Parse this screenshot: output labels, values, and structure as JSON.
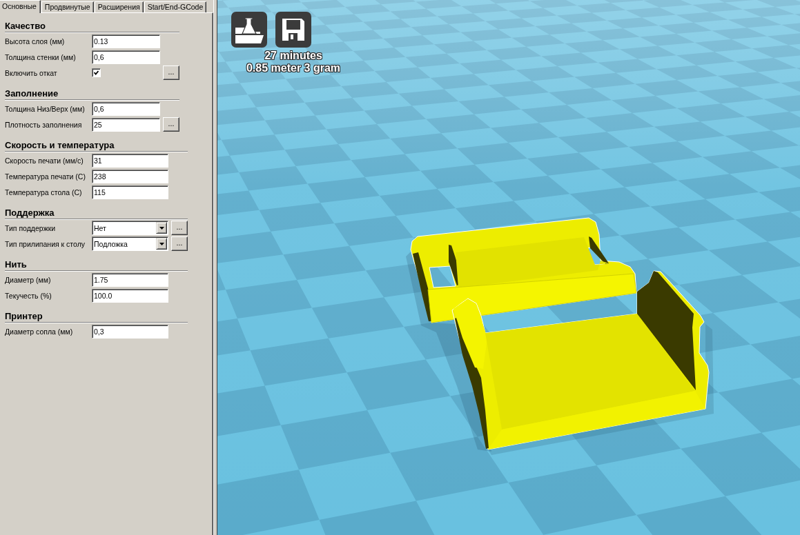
{
  "tabs": [
    {
      "label": "Основные",
      "selected": true
    },
    {
      "label": "Продвинутые",
      "selected": false
    },
    {
      "label": "Расширения",
      "selected": false
    },
    {
      "label": "Start/End-GCode",
      "selected": false
    }
  ],
  "sections": [
    {
      "title": "Качество",
      "rows": [
        {
          "kind": "text",
          "label": "Высота слоя (мм)",
          "value": "0.13"
        },
        {
          "kind": "text",
          "label": "Толщина стенки (мм)",
          "value": "0,6"
        },
        {
          "kind": "checkbox",
          "label": "Включить откат",
          "checked": true,
          "more": "..."
        }
      ]
    },
    {
      "title": "Заполнение",
      "rows": [
        {
          "kind": "text",
          "label": "Толщина Низ/Верх (мм)",
          "value": "0,6"
        },
        {
          "kind": "text",
          "label": "Плотность заполнения",
          "value": "25",
          "more": "..."
        }
      ]
    },
    {
      "title": "Скорость и температура",
      "rows": [
        {
          "kind": "text",
          "label": "Скорость печати (мм/с)",
          "value": "31"
        },
        {
          "kind": "text",
          "label": "Температура печати (С)",
          "value": "238"
        },
        {
          "kind": "text",
          "label": "Температура стола (С)",
          "value": "115"
        }
      ]
    },
    {
      "title": "Поддержка",
      "rows": [
        {
          "kind": "dropdown",
          "label": "Тип поддержки",
          "value": "Нет",
          "more": "..."
        },
        {
          "kind": "dropdown",
          "label": "Тип прилипания к столу",
          "value": "Подложка",
          "more": "..."
        }
      ]
    },
    {
      "title": "Нить",
      "rows": [
        {
          "kind": "text",
          "label": "Диаметр (мм)",
          "value": "1.75"
        },
        {
          "kind": "text",
          "label": "Текучесть (%)",
          "value": "100.0"
        }
      ]
    },
    {
      "title": "Принтер",
      "rows": [
        {
          "kind": "text",
          "label": "Диаметр сопла (мм)",
          "value": "0,3"
        }
      ]
    }
  ],
  "viewport": {
    "print_time": "27 minutes",
    "print_material": "0.85 meter 3 gram"
  }
}
